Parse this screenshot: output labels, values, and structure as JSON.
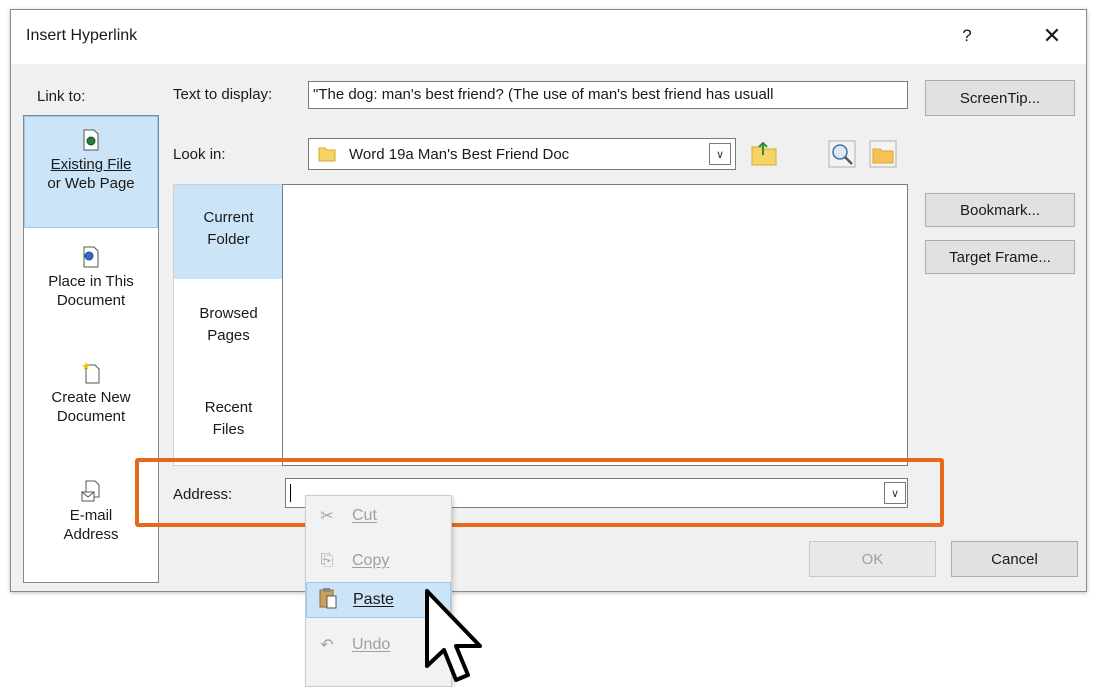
{
  "window": {
    "title": "Insert Hyperlink",
    "help_glyph": "?",
    "close_glyph": "✕"
  },
  "link_to": {
    "label": "Link to:",
    "items": [
      {
        "line1": "Existing File",
        "line2": "or Web Page",
        "icon": "existing-file-icon",
        "selected": true
      },
      {
        "line1": "Place in This",
        "line2": "Document",
        "icon": "place-in-document-icon"
      },
      {
        "line1": "Create New",
        "line2": "Document",
        "icon": "new-document-icon"
      },
      {
        "line1": "E-mail",
        "line2": "Address",
        "icon": "email-icon"
      }
    ]
  },
  "text_to_display": {
    "label": "Text to display:",
    "value": "\"The dog: man's best friend? (The use of man's best friend has usuall"
  },
  "screentip_label": "ScreenTip...",
  "look_in": {
    "label": "Look in:",
    "value": "Word 19a Man's Best Friend Doc"
  },
  "places": {
    "current": {
      "line1": "Current",
      "line2": "Folder"
    },
    "browsed": {
      "line1": "Browsed",
      "line2": "Pages"
    },
    "recent": {
      "line1": "Recent",
      "line2": "Files"
    }
  },
  "bookmark_label": "Bookmark...",
  "target_frame_label": "Target Frame...",
  "address": {
    "label": "Address:",
    "value": ""
  },
  "ok_label": "OK",
  "cancel_label": "Cancel",
  "context_menu": {
    "cut": "Cut",
    "copy": "Copy",
    "paste": "Paste",
    "undo": "Undo"
  },
  "colors": {
    "accent_highlight": "#e5691c",
    "selection": "#cce4f7"
  }
}
